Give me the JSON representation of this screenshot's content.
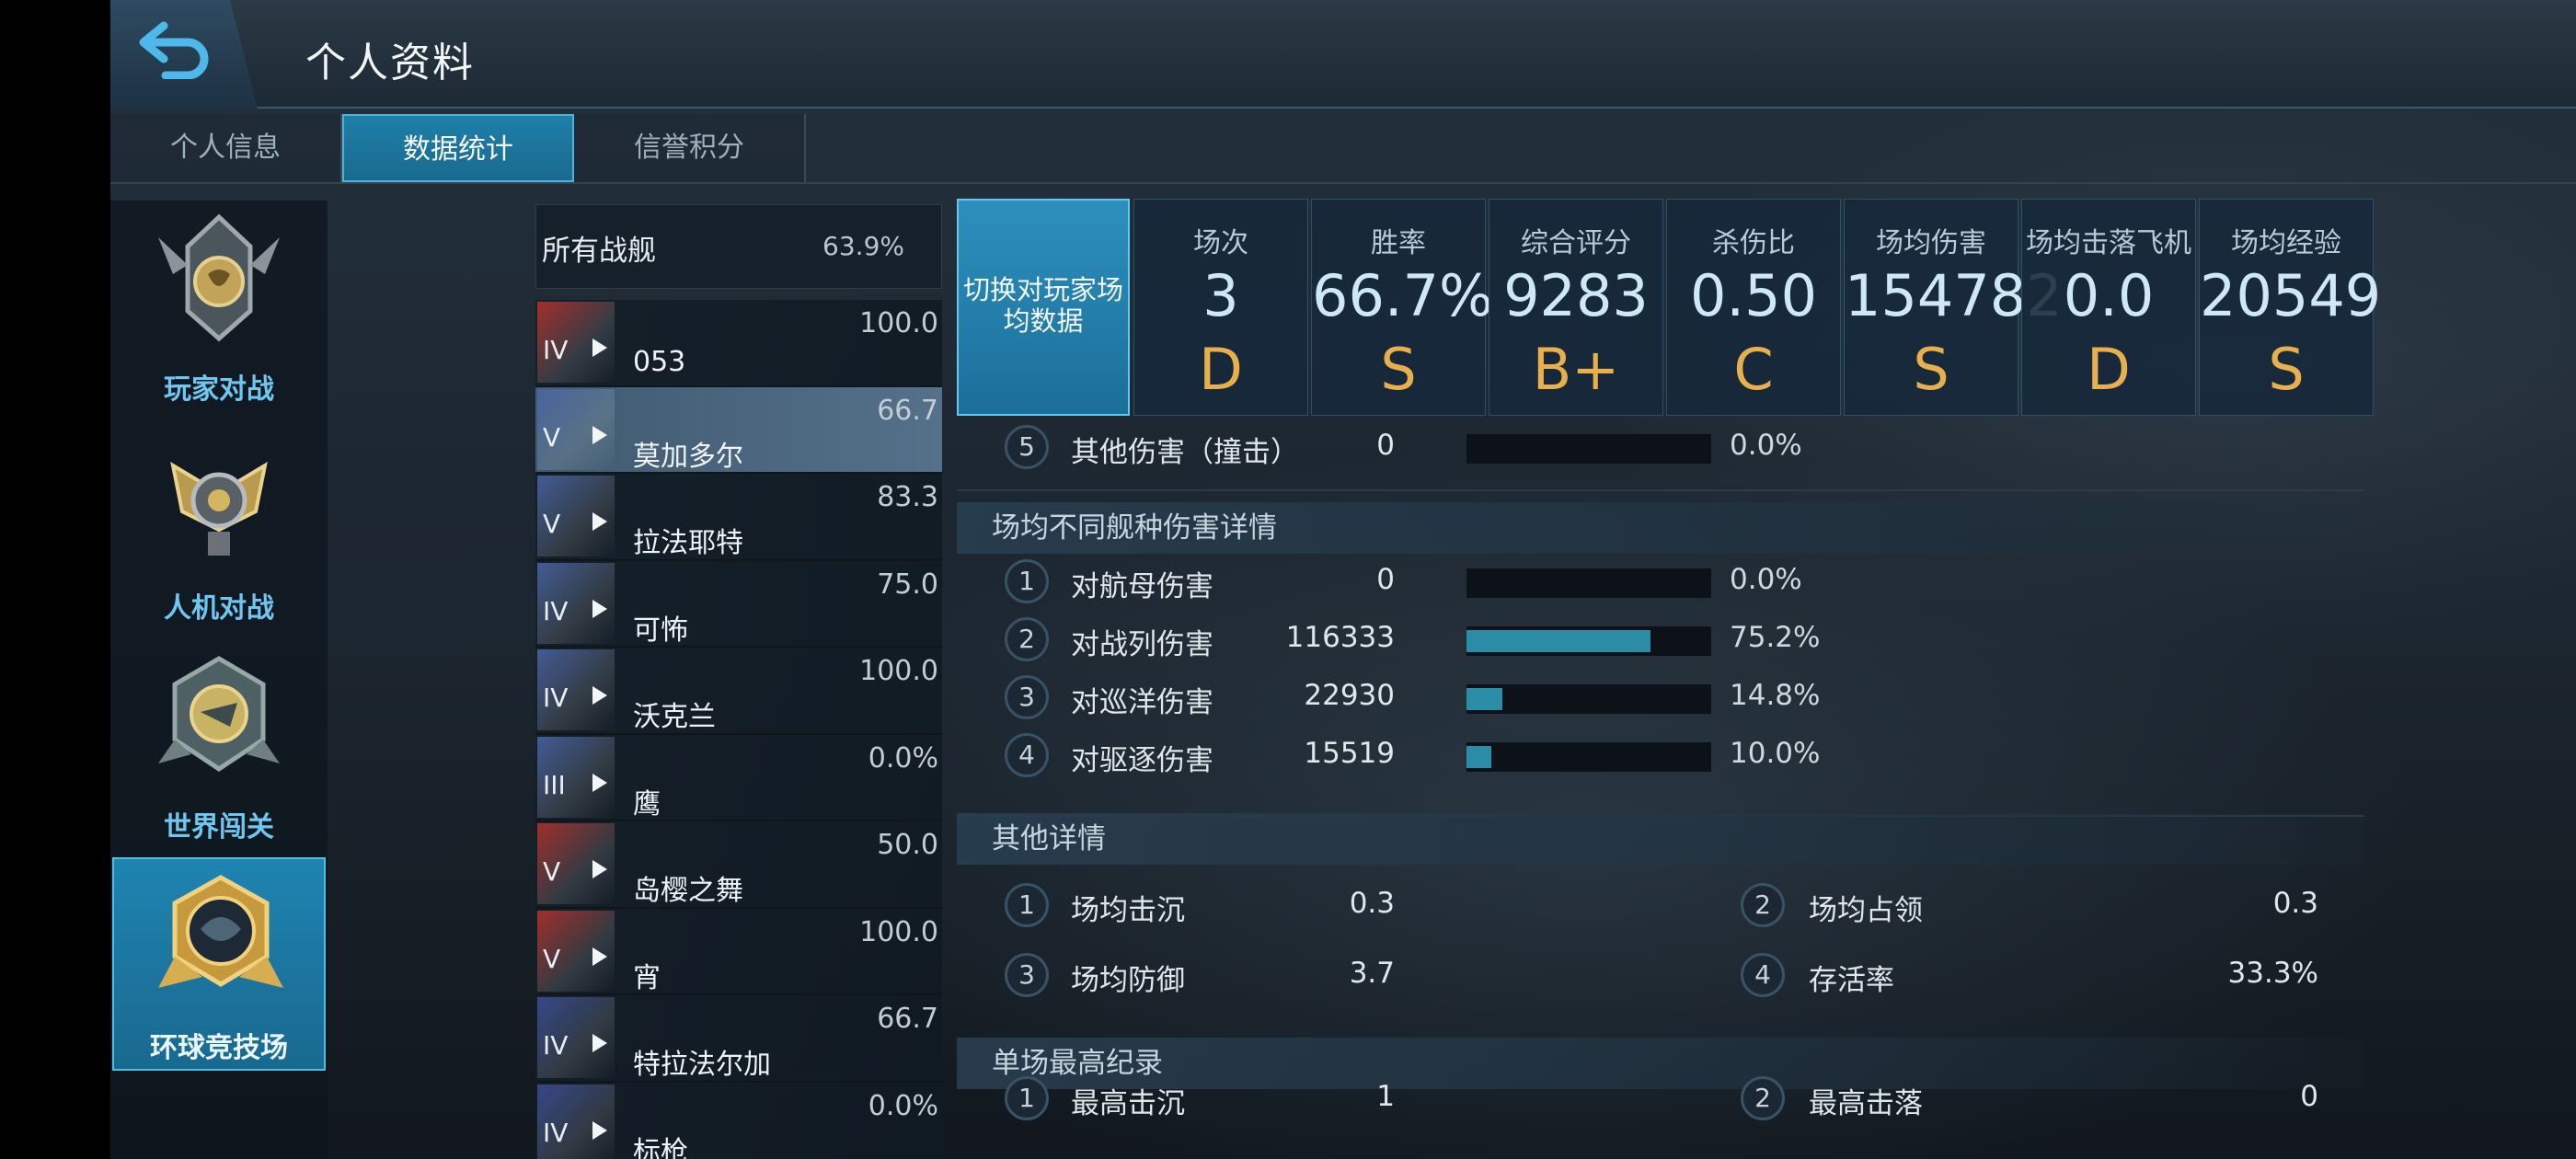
{
  "header": {
    "title": "个人资料"
  },
  "tabs": [
    {
      "label": "个人信息"
    },
    {
      "label": "数据统计",
      "active": true
    },
    {
      "label": "信誉积分"
    }
  ],
  "modes": [
    {
      "label": "玩家对战",
      "icon": "pvp-emblem-icon"
    },
    {
      "label": "人机对战",
      "icon": "pve-emblem-icon"
    },
    {
      "label": "世界闯关",
      "icon": "world-emblem-icon"
    },
    {
      "label": "环球竞技场",
      "icon": "arena-emblem-icon",
      "active": true
    }
  ],
  "ships_header": {
    "label": "所有战舰",
    "win_rate": "63.9%"
  },
  "ships": [
    {
      "tier": "IV",
      "name": "053",
      "win": "100.0",
      "flag_color": "#b8322c"
    },
    {
      "tier": "V",
      "name": "莫加多尔",
      "win": "66.7",
      "flag_color": "#4a66a8",
      "active": true
    },
    {
      "tier": "V",
      "name": "拉法耶特",
      "win": "83.3",
      "flag_color": "#4a66a8"
    },
    {
      "tier": "IV",
      "name": "可怖",
      "win": "75.0",
      "flag_color": "#4a66a8"
    },
    {
      "tier": "IV",
      "name": "沃克兰",
      "win": "100.0",
      "flag_color": "#4a66a8"
    },
    {
      "tier": "III",
      "name": "鹰",
      "win": "0.0%",
      "flag_color": "#4a66a8"
    },
    {
      "tier": "V",
      "name": "岛樱之舞",
      "win": "50.0",
      "flag_color": "#b8322c"
    },
    {
      "tier": "V",
      "name": "宵",
      "win": "100.0",
      "flag_color": "#b8322c"
    },
    {
      "tier": "IV",
      "name": "特拉法尔加",
      "win": "66.7",
      "flag_color": "#3a4f9a"
    },
    {
      "tier": "IV",
      "name": "标枪",
      "win": "0.0%",
      "flag_color": "#3a4f9a"
    }
  ],
  "toggle_button": {
    "line1": "切换对玩家场",
    "line2": "均数据"
  },
  "stats": [
    {
      "label": "场次",
      "value": "3",
      "grade": "D"
    },
    {
      "label": "胜率",
      "value": "66.7%",
      "grade": "S"
    },
    {
      "label": "综合评分",
      "value": "9283",
      "grade": "B+"
    },
    {
      "label": "杀伤比",
      "value": "0.50",
      "grade": "C"
    },
    {
      "label": "场均伤害",
      "value": "154782",
      "grade": "S"
    },
    {
      "label": "场均击落飞机",
      "value": "0.0",
      "grade": "D"
    },
    {
      "label": "场均经验",
      "value": "20549",
      "grade": "S"
    }
  ],
  "other_damage": {
    "num": "5",
    "label": "其他伤害（撞击）",
    "value": "0",
    "pct": "0.0%",
    "fill": 0
  },
  "ship_type_section": {
    "title": "场均不同舰种伤害详情",
    "rows": [
      {
        "num": "1",
        "label": "对航母伤害",
        "value": "0",
        "pct": "0.0%",
        "fill": 0
      },
      {
        "num": "2",
        "label": "对战列伤害",
        "value": "116333",
        "pct": "75.2%",
        "fill": 0.752
      },
      {
        "num": "3",
        "label": "对巡洋伤害",
        "value": "22930",
        "pct": "14.8%",
        "fill": 0.148
      },
      {
        "num": "4",
        "label": "对驱逐伤害",
        "value": "15519",
        "pct": "10.0%",
        "fill": 0.1
      }
    ]
  },
  "other_section": {
    "title": "其他详情",
    "rows": [
      {
        "n1": "1",
        "l1": "场均击沉",
        "v1": "0.3",
        "n2": "2",
        "l2": "场均占领",
        "v2": "0.3"
      },
      {
        "n1": "3",
        "l1": "场均防御",
        "v1": "3.7",
        "n2": "4",
        "l2": "存活率",
        "v2": "33.3%"
      }
    ]
  },
  "record_section": {
    "title": "单场最高纪录",
    "rows": [
      {
        "n1": "1",
        "l1": "最高击沉",
        "v1": "1",
        "n2": "2",
        "l2": "最高击落",
        "v2": "0"
      }
    ]
  },
  "colors": {
    "accent": "#1f7fa8",
    "grade": "#e8b04d",
    "bar": "#2a8ca6"
  }
}
